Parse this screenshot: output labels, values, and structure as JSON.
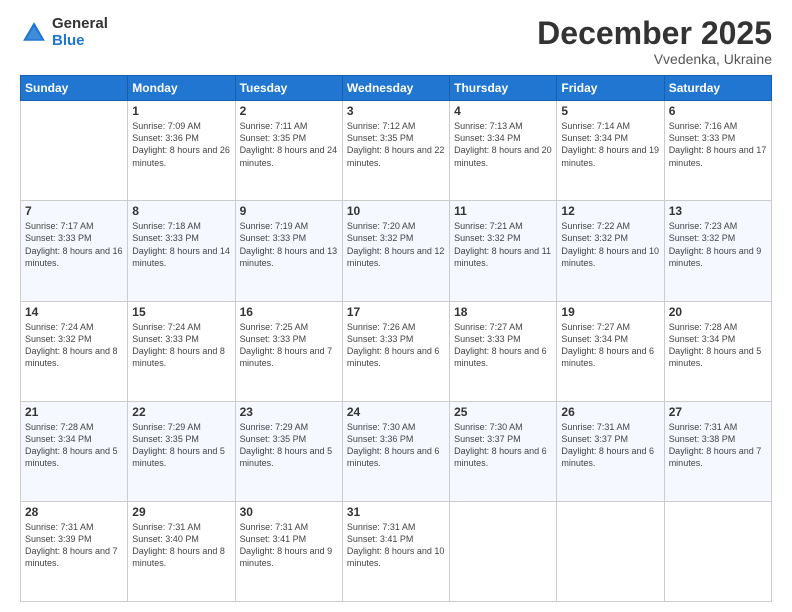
{
  "logo": {
    "general": "General",
    "blue": "Blue"
  },
  "header": {
    "month": "December 2025",
    "location": "Vvedenka, Ukraine"
  },
  "weekdays": [
    "Sunday",
    "Monday",
    "Tuesday",
    "Wednesday",
    "Thursday",
    "Friday",
    "Saturday"
  ],
  "weeks": [
    [
      {
        "day": "",
        "sunrise": "",
        "sunset": "",
        "daylight": ""
      },
      {
        "day": "1",
        "sunrise": "Sunrise: 7:09 AM",
        "sunset": "Sunset: 3:36 PM",
        "daylight": "Daylight: 8 hours and 26 minutes."
      },
      {
        "day": "2",
        "sunrise": "Sunrise: 7:11 AM",
        "sunset": "Sunset: 3:35 PM",
        "daylight": "Daylight: 8 hours and 24 minutes."
      },
      {
        "day": "3",
        "sunrise": "Sunrise: 7:12 AM",
        "sunset": "Sunset: 3:35 PM",
        "daylight": "Daylight: 8 hours and 22 minutes."
      },
      {
        "day": "4",
        "sunrise": "Sunrise: 7:13 AM",
        "sunset": "Sunset: 3:34 PM",
        "daylight": "Daylight: 8 hours and 20 minutes."
      },
      {
        "day": "5",
        "sunrise": "Sunrise: 7:14 AM",
        "sunset": "Sunset: 3:34 PM",
        "daylight": "Daylight: 8 hours and 19 minutes."
      },
      {
        "day": "6",
        "sunrise": "Sunrise: 7:16 AM",
        "sunset": "Sunset: 3:33 PM",
        "daylight": "Daylight: 8 hours and 17 minutes."
      }
    ],
    [
      {
        "day": "7",
        "sunrise": "Sunrise: 7:17 AM",
        "sunset": "Sunset: 3:33 PM",
        "daylight": "Daylight: 8 hours and 16 minutes."
      },
      {
        "day": "8",
        "sunrise": "Sunrise: 7:18 AM",
        "sunset": "Sunset: 3:33 PM",
        "daylight": "Daylight: 8 hours and 14 minutes."
      },
      {
        "day": "9",
        "sunrise": "Sunrise: 7:19 AM",
        "sunset": "Sunset: 3:33 PM",
        "daylight": "Daylight: 8 hours and 13 minutes."
      },
      {
        "day": "10",
        "sunrise": "Sunrise: 7:20 AM",
        "sunset": "Sunset: 3:32 PM",
        "daylight": "Daylight: 8 hours and 12 minutes."
      },
      {
        "day": "11",
        "sunrise": "Sunrise: 7:21 AM",
        "sunset": "Sunset: 3:32 PM",
        "daylight": "Daylight: 8 hours and 11 minutes."
      },
      {
        "day": "12",
        "sunrise": "Sunrise: 7:22 AM",
        "sunset": "Sunset: 3:32 PM",
        "daylight": "Daylight: 8 hours and 10 minutes."
      },
      {
        "day": "13",
        "sunrise": "Sunrise: 7:23 AM",
        "sunset": "Sunset: 3:32 PM",
        "daylight": "Daylight: 8 hours and 9 minutes."
      }
    ],
    [
      {
        "day": "14",
        "sunrise": "Sunrise: 7:24 AM",
        "sunset": "Sunset: 3:32 PM",
        "daylight": "Daylight: 8 hours and 8 minutes."
      },
      {
        "day": "15",
        "sunrise": "Sunrise: 7:24 AM",
        "sunset": "Sunset: 3:33 PM",
        "daylight": "Daylight: 8 hours and 8 minutes."
      },
      {
        "day": "16",
        "sunrise": "Sunrise: 7:25 AM",
        "sunset": "Sunset: 3:33 PM",
        "daylight": "Daylight: 8 hours and 7 minutes."
      },
      {
        "day": "17",
        "sunrise": "Sunrise: 7:26 AM",
        "sunset": "Sunset: 3:33 PM",
        "daylight": "Daylight: 8 hours and 6 minutes."
      },
      {
        "day": "18",
        "sunrise": "Sunrise: 7:27 AM",
        "sunset": "Sunset: 3:33 PM",
        "daylight": "Daylight: 8 hours and 6 minutes."
      },
      {
        "day": "19",
        "sunrise": "Sunrise: 7:27 AM",
        "sunset": "Sunset: 3:34 PM",
        "daylight": "Daylight: 8 hours and 6 minutes."
      },
      {
        "day": "20",
        "sunrise": "Sunrise: 7:28 AM",
        "sunset": "Sunset: 3:34 PM",
        "daylight": "Daylight: 8 hours and 5 minutes."
      }
    ],
    [
      {
        "day": "21",
        "sunrise": "Sunrise: 7:28 AM",
        "sunset": "Sunset: 3:34 PM",
        "daylight": "Daylight: 8 hours and 5 minutes."
      },
      {
        "day": "22",
        "sunrise": "Sunrise: 7:29 AM",
        "sunset": "Sunset: 3:35 PM",
        "daylight": "Daylight: 8 hours and 5 minutes."
      },
      {
        "day": "23",
        "sunrise": "Sunrise: 7:29 AM",
        "sunset": "Sunset: 3:35 PM",
        "daylight": "Daylight: 8 hours and 5 minutes."
      },
      {
        "day": "24",
        "sunrise": "Sunrise: 7:30 AM",
        "sunset": "Sunset: 3:36 PM",
        "daylight": "Daylight: 8 hours and 6 minutes."
      },
      {
        "day": "25",
        "sunrise": "Sunrise: 7:30 AM",
        "sunset": "Sunset: 3:37 PM",
        "daylight": "Daylight: 8 hours and 6 minutes."
      },
      {
        "day": "26",
        "sunrise": "Sunrise: 7:31 AM",
        "sunset": "Sunset: 3:37 PM",
        "daylight": "Daylight: 8 hours and 6 minutes."
      },
      {
        "day": "27",
        "sunrise": "Sunrise: 7:31 AM",
        "sunset": "Sunset: 3:38 PM",
        "daylight": "Daylight: 8 hours and 7 minutes."
      }
    ],
    [
      {
        "day": "28",
        "sunrise": "Sunrise: 7:31 AM",
        "sunset": "Sunset: 3:39 PM",
        "daylight": "Daylight: 8 hours and 7 minutes."
      },
      {
        "day": "29",
        "sunrise": "Sunrise: 7:31 AM",
        "sunset": "Sunset: 3:40 PM",
        "daylight": "Daylight: 8 hours and 8 minutes."
      },
      {
        "day": "30",
        "sunrise": "Sunrise: 7:31 AM",
        "sunset": "Sunset: 3:41 PM",
        "daylight": "Daylight: 8 hours and 9 minutes."
      },
      {
        "day": "31",
        "sunrise": "Sunrise: 7:31 AM",
        "sunset": "Sunset: 3:41 PM",
        "daylight": "Daylight: 8 hours and 10 minutes."
      },
      {
        "day": "",
        "sunrise": "",
        "sunset": "",
        "daylight": ""
      },
      {
        "day": "",
        "sunrise": "",
        "sunset": "",
        "daylight": ""
      },
      {
        "day": "",
        "sunrise": "",
        "sunset": "",
        "daylight": ""
      }
    ]
  ]
}
